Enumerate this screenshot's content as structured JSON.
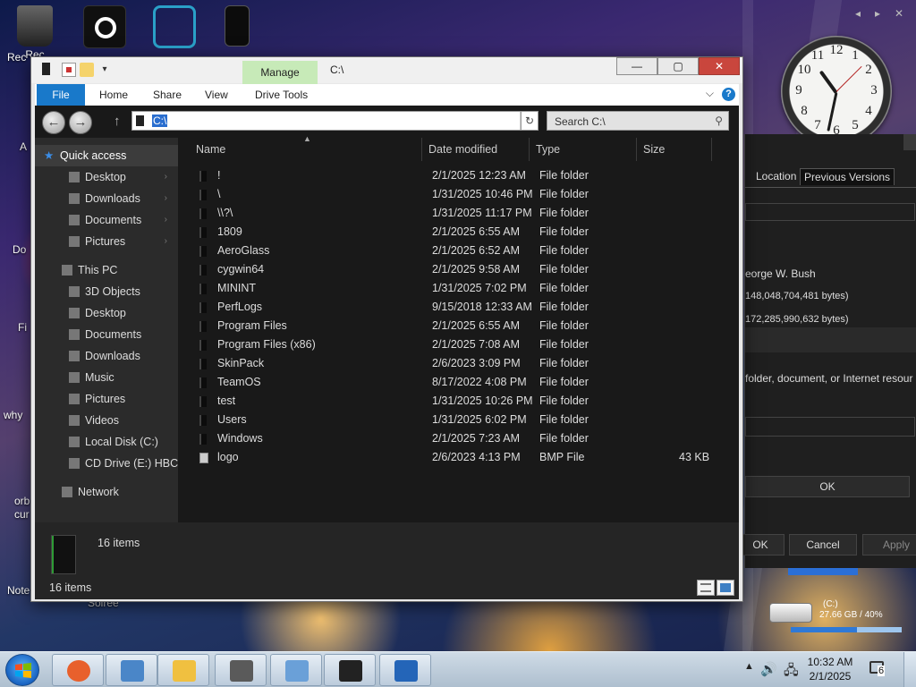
{
  "desktop": {
    "icons": [
      {
        "label": "Rec",
        "icon": "recycle-bin-icon"
      },
      {
        "label": "",
        "icon": "steam-icon"
      },
      {
        "label": "",
        "icon": "cheat-engine-icon"
      },
      {
        "label": "",
        "icon": "drive-icon"
      }
    ],
    "side_labels": [
      "A",
      "Do",
      "Fi",
      "why",
      "orb",
      "cur",
      "Note"
    ],
    "gadget_controls": {
      "prev": "◂",
      "next": "▸",
      "close": "✕"
    },
    "partial_text": "Soiree"
  },
  "clock_gadget": {
    "numbers": [
      "12",
      "1",
      "2",
      "3",
      "4",
      "5",
      "6",
      "7",
      "8",
      "9",
      "10",
      "11"
    ],
    "time": "10:32"
  },
  "properties_dialog": {
    "tabs": [
      "Location",
      "Previous Versions"
    ],
    "owner_fragment": "eorge W. Bush",
    "line1": "148,048,704,481 bytes)",
    "line2": "172,285,990,632 bytes)",
    "prompt": "folder, document, or Internet resour",
    "ok_large": "OK",
    "ok": "OK",
    "cancel": "Cancel",
    "apply": "Apply"
  },
  "window": {
    "title": "C:\\",
    "manage_tab": "Manage",
    "caption": {
      "minimize": "—",
      "maximize": "▢",
      "close": "✕"
    },
    "ribbon": {
      "file": "File",
      "tabs": [
        "Home",
        "Share",
        "View",
        "Drive Tools"
      ],
      "help": "?",
      "expand": "⌵"
    },
    "address": "C:\\",
    "search_placeholder": "Search C:\\",
    "nav": {
      "quick_access": "Quick access",
      "quick_items": [
        "Desktop",
        "Downloads",
        "Documents",
        "Pictures"
      ],
      "this_pc": "This PC",
      "pc_items": [
        "3D Objects",
        "Desktop",
        "Documents",
        "Downloads",
        "Music",
        "Pictures",
        "Videos",
        "Local Disk (C:)",
        "CD Drive (E:) HBCD_"
      ],
      "network": "Network"
    },
    "columns": {
      "name": "Name",
      "date": "Date modified",
      "type": "Type",
      "size": "Size"
    },
    "files": [
      {
        "name": "!",
        "date": "2/1/2025 12:23 AM",
        "type": "File folder",
        "size": "",
        "kind": "folder"
      },
      {
        "name": "\\",
        "date": "1/31/2025 10:46 PM",
        "type": "File folder",
        "size": "",
        "kind": "folder"
      },
      {
        "name": "\\\\?\\",
        "date": "1/31/2025 11:17 PM",
        "type": "File folder",
        "size": "",
        "kind": "folder"
      },
      {
        "name": "1809",
        "date": "2/1/2025 6:55 AM",
        "type": "File folder",
        "size": "",
        "kind": "folder"
      },
      {
        "name": "AeroGlass",
        "date": "2/1/2025 6:52 AM",
        "type": "File folder",
        "size": "",
        "kind": "folder"
      },
      {
        "name": "cygwin64",
        "date": "2/1/2025 9:58 AM",
        "type": "File folder",
        "size": "",
        "kind": "folder"
      },
      {
        "name": "MININT",
        "date": "1/31/2025 7:02 PM",
        "type": "File folder",
        "size": "",
        "kind": "folder"
      },
      {
        "name": "PerfLogs",
        "date": "9/15/2018 12:33 AM",
        "type": "File folder",
        "size": "",
        "kind": "folder"
      },
      {
        "name": "Program Files",
        "date": "2/1/2025 6:55 AM",
        "type": "File folder",
        "size": "",
        "kind": "folder"
      },
      {
        "name": "Program Files (x86)",
        "date": "2/1/2025 7:08 AM",
        "type": "File folder",
        "size": "",
        "kind": "folder"
      },
      {
        "name": "SkinPack",
        "date": "2/6/2023 3:09 PM",
        "type": "File folder",
        "size": "",
        "kind": "folder"
      },
      {
        "name": "TeamOS",
        "date": "8/17/2022 4:08 PM",
        "type": "File folder",
        "size": "",
        "kind": "folder"
      },
      {
        "name": "test",
        "date": "1/31/2025 10:26 PM",
        "type": "File folder",
        "size": "",
        "kind": "folder"
      },
      {
        "name": "Users",
        "date": "1/31/2025 6:02 PM",
        "type": "File folder",
        "size": "",
        "kind": "folder"
      },
      {
        "name": "Windows",
        "date": "2/1/2025 7:23 AM",
        "type": "File folder",
        "size": "",
        "kind": "folder"
      },
      {
        "name": "logo",
        "date": "2/6/2023 4:13 PM",
        "type": "BMP File",
        "size": "43 KB",
        "kind": "file"
      }
    ],
    "details_count": "16 items",
    "status": "16 items"
  },
  "drive_gadget": {
    "label": "(C:)",
    "usage": "27.66 GB / 40%",
    "used_fraction": 0.6
  },
  "taskbar": {
    "apps": [
      "firefox-icon",
      "remote-desktop-icon",
      "file-explorer-icon",
      "notepad-icon",
      "control-panel-icon",
      "terminal-icon",
      "powershell-icon"
    ],
    "tray": {
      "arrow": "▲",
      "volume": "🔊",
      "network": "🖧"
    },
    "time": "10:32 AM",
    "date": "2/1/2025",
    "notifications": "6"
  },
  "colors": {
    "accent": "#1979ca",
    "manage": "#c7eab8",
    "close": "#c9463d",
    "selection": "#2a6ecf"
  }
}
